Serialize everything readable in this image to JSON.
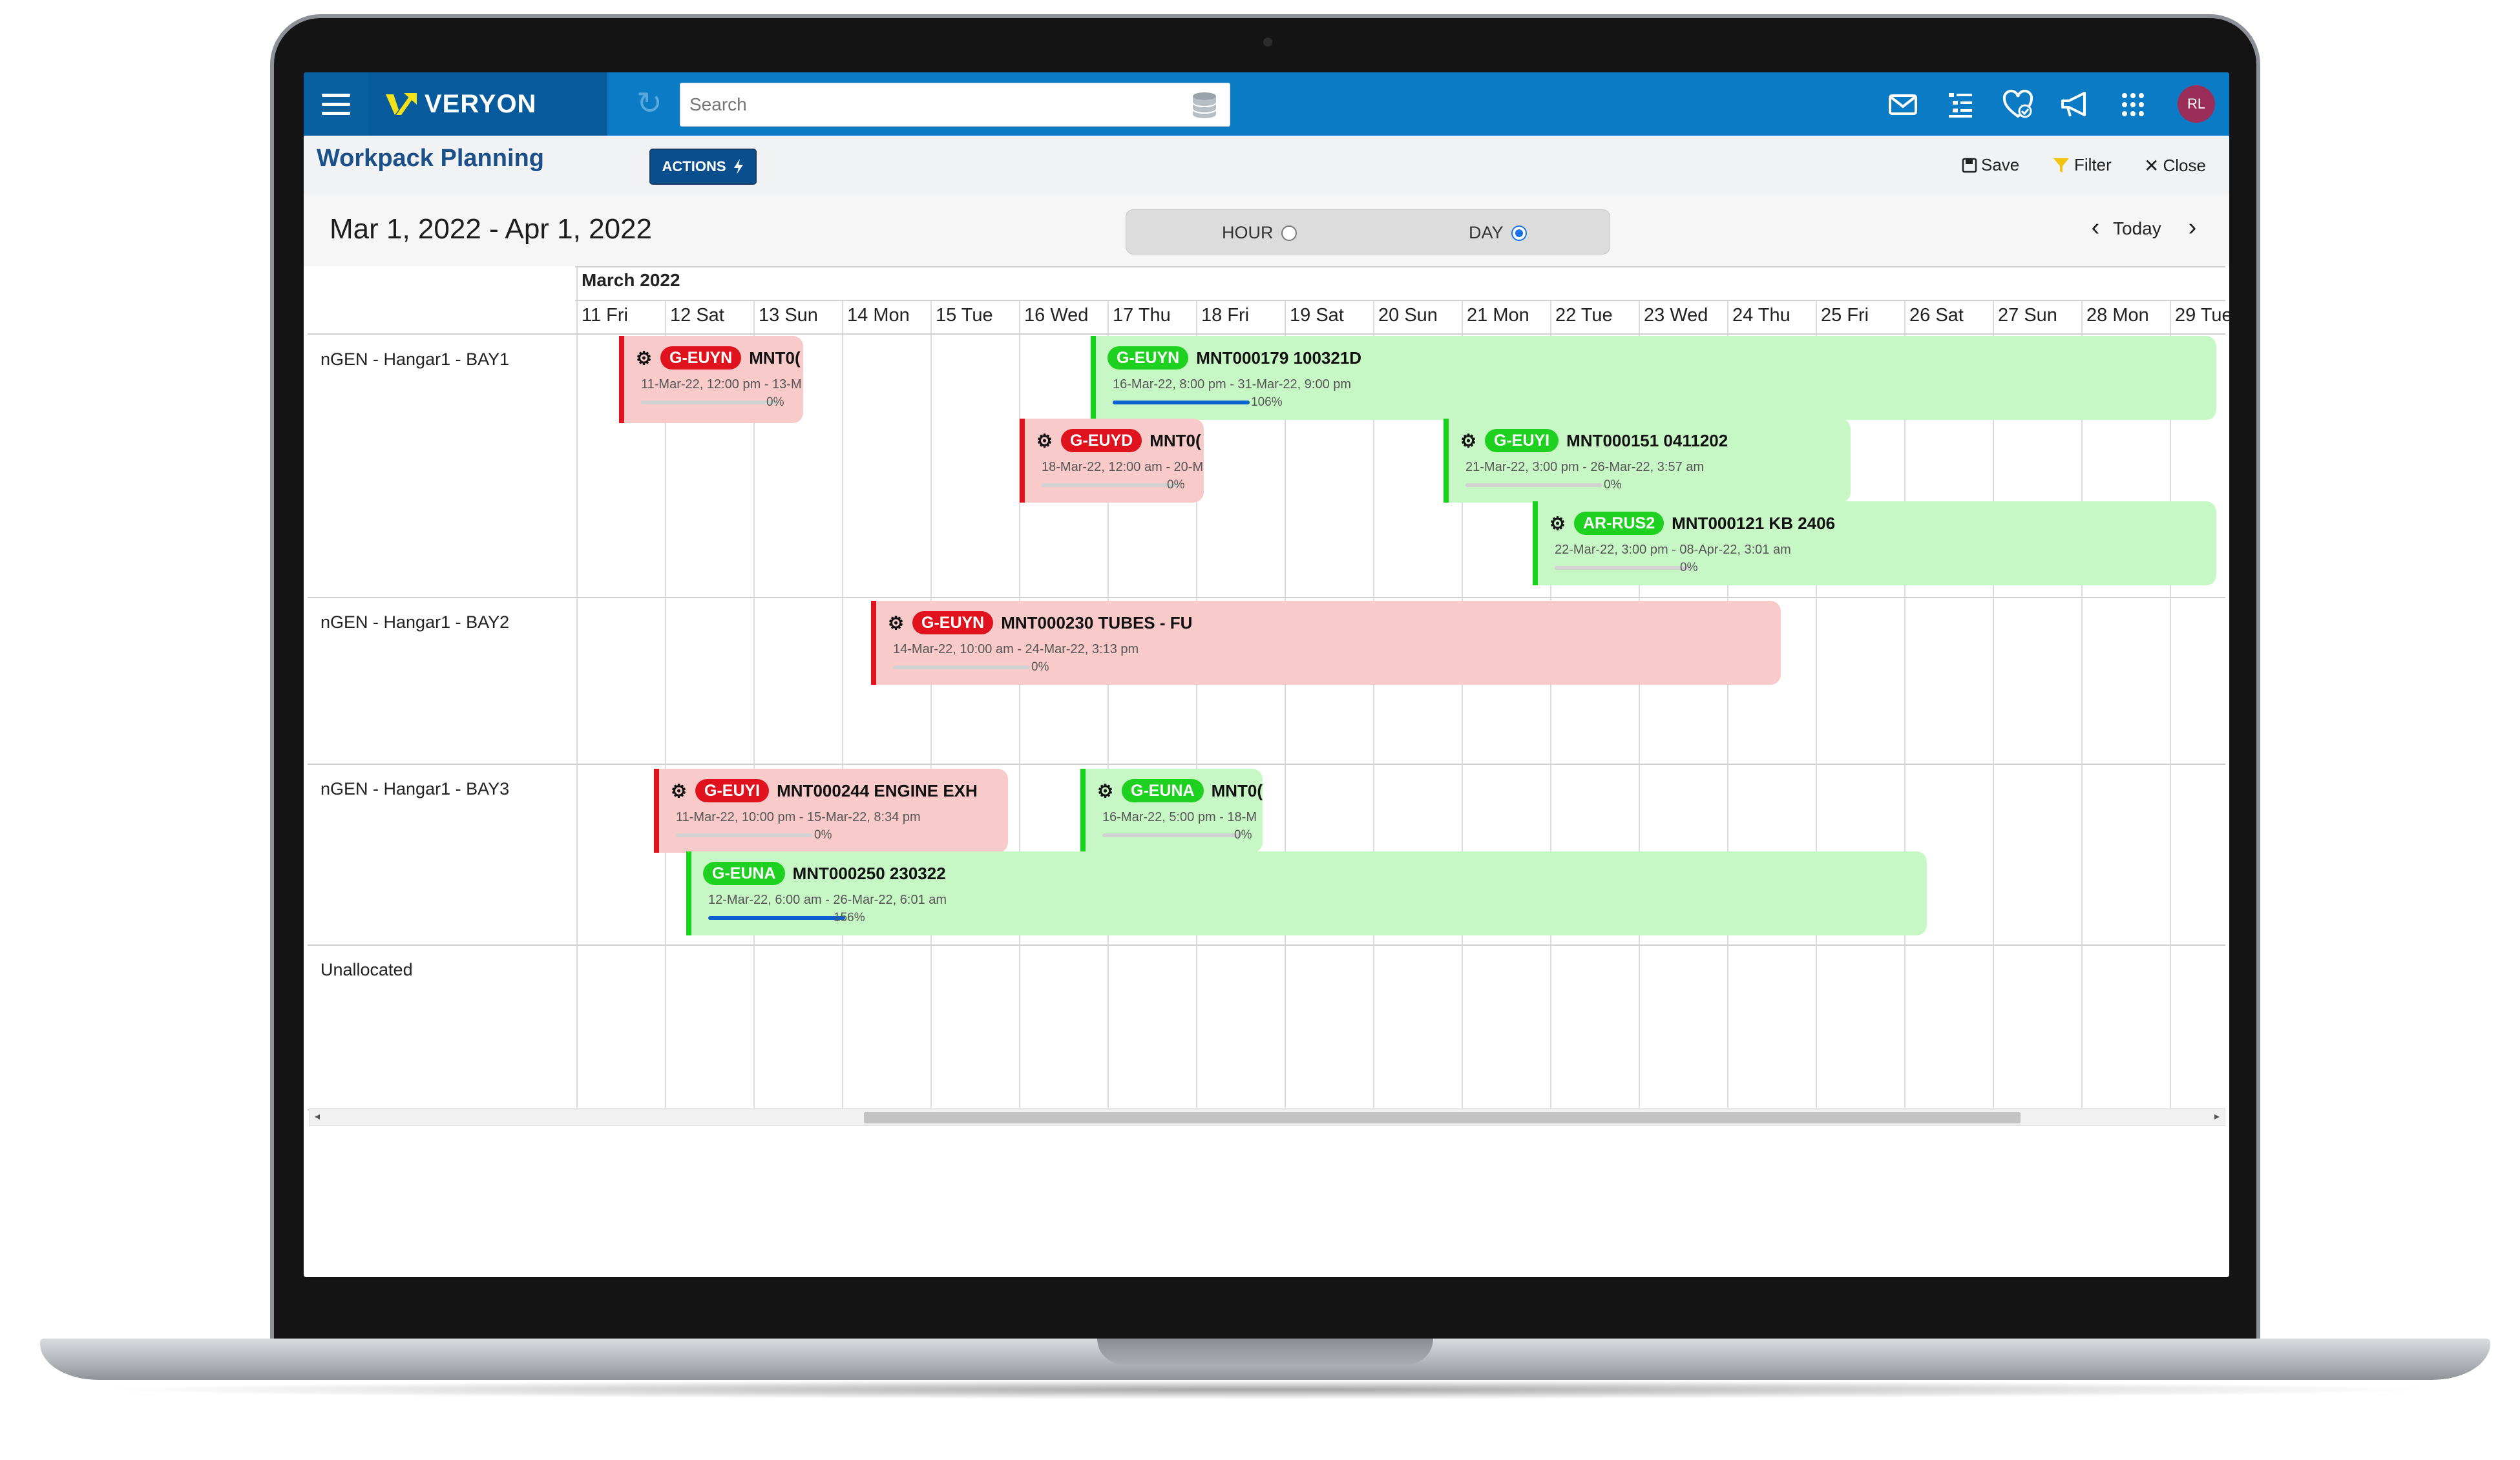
{
  "app": {
    "brand": "VERYON",
    "user_initials": "RL",
    "colors": {
      "topbar": "#0a7bc4",
      "brand_dark": "#075a9b",
      "red_task": "#f8caca",
      "green_task": "#c8f7c6",
      "red_tag": "#e0121e",
      "green_tag": "#1ed01f",
      "progress": "#0c5fd1"
    }
  },
  "search": {
    "placeholder": "Search",
    "value": ""
  },
  "header": {
    "title": "Workpack Planning",
    "actions_label": "ACTIONS",
    "save_label": "Save",
    "filter_label": "Filter",
    "close_label": "Close"
  },
  "range": {
    "label": "Mar 1, 2022 - Apr 1, 2022",
    "hour_label": "HOUR",
    "day_label": "DAY",
    "selected": "DAY",
    "today_label": "Today"
  },
  "timeline": {
    "month": "March 2022",
    "days": [
      "11 Fri",
      "12 Sat",
      "13 Sun",
      "14 Mon",
      "15 Tue",
      "16 Wed",
      "17 Thu",
      "18 Fri",
      "19 Sat",
      "20 Sun",
      "21 Mon",
      "22 Tue",
      "23 Wed",
      "24 Thu",
      "25 Fri",
      "26 Sat",
      "27 Sun",
      "28 Mon",
      "29 Tue"
    ]
  },
  "rows": [
    "nGEN - Hangar1 - BAY1",
    "nGEN - Hangar1 - BAY2",
    "nGEN - Hangar1 - BAY3",
    "Unallocated"
  ],
  "tasks": [
    {
      "row": 0,
      "color": "red",
      "gear": true,
      "tag": "G-EUYN",
      "title": "MNT0(",
      "dates": "11-Mar-22, 12:00 pm - 13-M",
      "progress": 0,
      "pct": "0%"
    },
    {
      "row": 0,
      "color": "green",
      "gear": false,
      "tag": "G-EUYN",
      "title": "MNT000179  100321D",
      "dates": "16-Mar-22, 8:00 pm - 31-Mar-22, 9:00 pm",
      "progress": 106,
      "pct": "106%"
    },
    {
      "row": 0,
      "color": "red",
      "gear": true,
      "tag": "G-EUYD",
      "title": "MNT0(",
      "dates": "18-Mar-22, 12:00 am - 20-M",
      "progress": 0,
      "pct": "0%"
    },
    {
      "row": 0,
      "color": "green",
      "gear": true,
      "tag": "G-EUYI",
      "title": "MNT000151  0411202",
      "dates": "21-Mar-22, 3:00 pm - 26-Mar-22, 3:57 am",
      "progress": 0,
      "pct": "0%"
    },
    {
      "row": 0,
      "color": "green",
      "gear": true,
      "tag": "AR-RUS2",
      "title": "MNT000121  KB 2406",
      "dates": "22-Mar-22, 3:00 pm - 08-Apr-22, 3:01 am",
      "progress": 0,
      "pct": "0%"
    },
    {
      "row": 1,
      "color": "red",
      "gear": true,
      "tag": "G-EUYN",
      "title": "MNT000230  TUBES - FU",
      "dates": "14-Mar-22, 10:00 am - 24-Mar-22, 3:13 pm",
      "progress": 0,
      "pct": "0%"
    },
    {
      "row": 2,
      "color": "red",
      "gear": true,
      "tag": "G-EUYI",
      "title": "MNT000244  ENGINE EXH",
      "dates": "11-Mar-22, 10:00 pm - 15-Mar-22, 8:34 pm",
      "progress": 0,
      "pct": "0%"
    },
    {
      "row": 2,
      "color": "green",
      "gear": true,
      "tag": "G-EUNA",
      "title": "MNT0(",
      "dates": "16-Mar-22, 5:00 pm - 18-M",
      "progress": 0,
      "pct": "0%"
    },
    {
      "row": 2,
      "color": "green",
      "gear": false,
      "tag": "G-EUNA",
      "title": "MNT000250  230322",
      "dates": "12-Mar-22, 6:00 am - 26-Mar-22, 6:01 am",
      "progress": 156,
      "pct": "156%"
    }
  ]
}
